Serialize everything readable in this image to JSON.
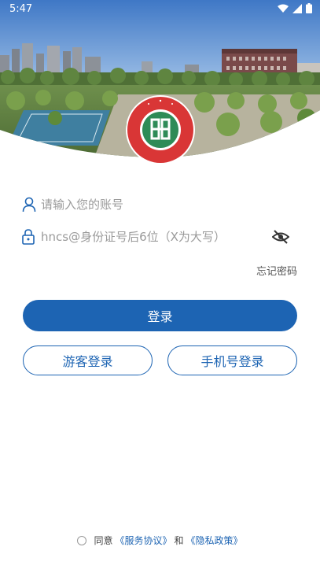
{
  "status": {
    "time": "5:47"
  },
  "logo": {
    "name": "HUNAN CITY UNIVERSITY"
  },
  "login": {
    "account_placeholder": "请输入您的账号",
    "password_placeholder": "hncs@身份证号后6位（X为大写）",
    "forgot": "忘记密码",
    "login_button": "登录",
    "guest_button": "游客登录",
    "phone_button": "手机号登录"
  },
  "agreement": {
    "prefix": "同意",
    "service": "《服务协议》",
    "and": "和",
    "privacy": "《隐私政策》"
  },
  "colors": {
    "accent": "#1d64b3",
    "logo_red": "#d93636",
    "logo_green": "#2e8b57"
  }
}
